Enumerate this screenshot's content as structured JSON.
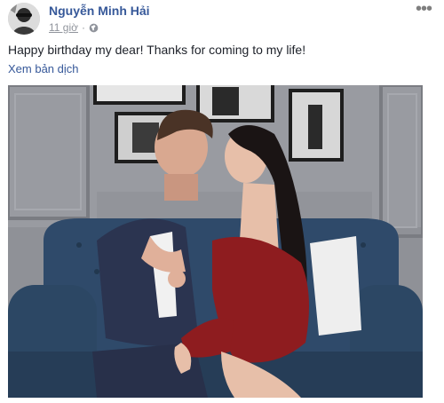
{
  "post": {
    "author": "Nguyễn Minh Hải",
    "timestamp": "11 giờ",
    "separator": "·",
    "privacy_icon": "globe-icon",
    "more_icon": "more-options-icon",
    "more_glyph": "•••",
    "message": "Happy birthday my dear! Thanks for coming to my life!",
    "see_translation": "Xem bản dịch",
    "photo_icon": "post-photo"
  },
  "colors": {
    "author_link": "#365899",
    "meta_text": "#90949c",
    "body_text": "#1d2129",
    "sofa": "#2f4a6a",
    "dress": "#8e1c1f",
    "suit": "#2b3450"
  }
}
